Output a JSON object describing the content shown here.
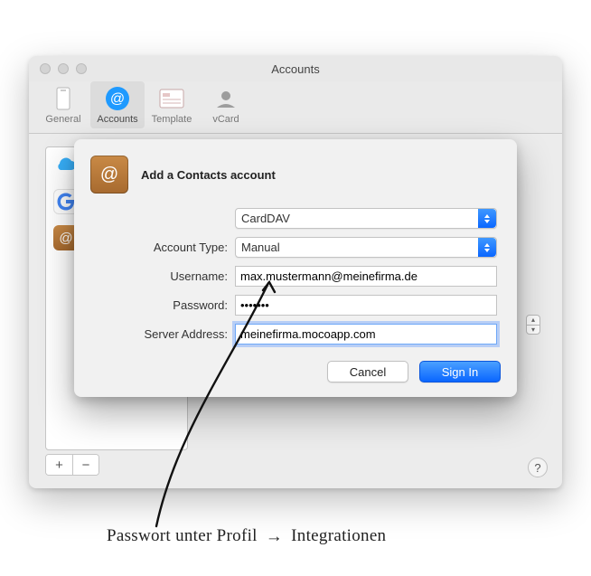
{
  "window": {
    "title": "Accounts"
  },
  "toolbar": {
    "items": [
      {
        "label": "General"
      },
      {
        "label": "Accounts"
      },
      {
        "label": "Template"
      },
      {
        "label": "vCard"
      }
    ]
  },
  "sidebar": {
    "accounts": [
      {
        "icon": "icloud"
      },
      {
        "icon": "google"
      },
      {
        "icon": "carddav"
      }
    ],
    "add_label": "+",
    "remove_label": "−"
  },
  "help_label": "?",
  "dialog": {
    "title": "Add a Contacts account",
    "provider": {
      "value": "CardDAV"
    },
    "account_type": {
      "label": "Account Type:",
      "value": "Manual"
    },
    "username": {
      "label": "Username:",
      "value": "max.mustermann@meinefirma.de"
    },
    "password": {
      "label": "Password:",
      "value": "•••••••"
    },
    "server": {
      "label": "Server Address:",
      "value": "meinefirma.mocoapp.com"
    },
    "cancel": "Cancel",
    "signin": "Sign In"
  },
  "annotation": {
    "text_a": "Passwort unter Profil",
    "arrow": "→",
    "text_b": "Integrationen"
  }
}
